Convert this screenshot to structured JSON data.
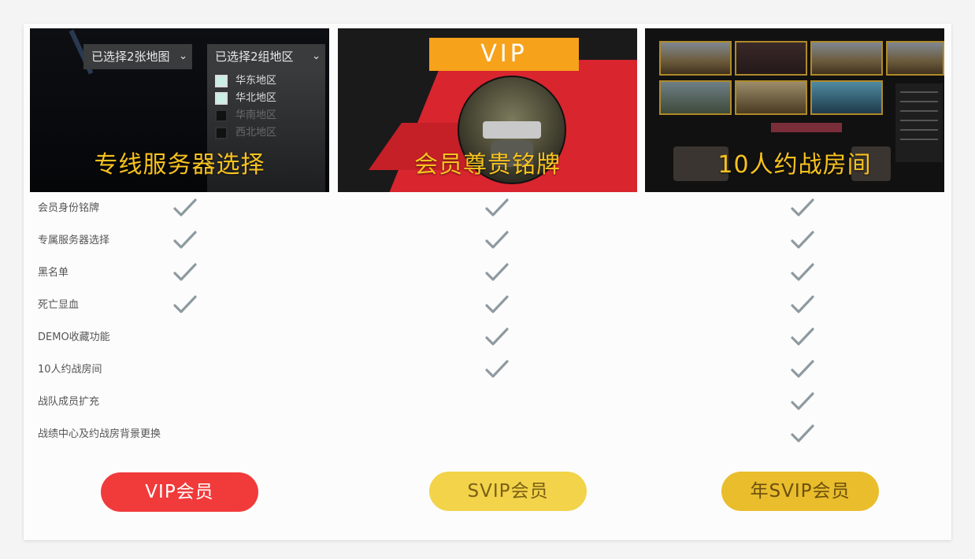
{
  "banners": [
    {
      "title": "专线服务器选择",
      "dropdown_maps": "已选择2张地图",
      "dropdown_regions": "已选择2组地区",
      "regions": [
        "华东地区",
        "华北地区",
        "华南地区",
        "西北地区"
      ]
    },
    {
      "title": "会员尊贵铭牌",
      "badge": "VIP"
    },
    {
      "title": "10人约战房间"
    }
  ],
  "features": [
    {
      "label": "会员身份铭牌",
      "vip": true,
      "svip": true,
      "year_svip": true
    },
    {
      "label": "专属服务器选择",
      "vip": true,
      "svip": true,
      "year_svip": true
    },
    {
      "label": "黑名单",
      "vip": true,
      "svip": true,
      "year_svip": true
    },
    {
      "label": "死亡显血",
      "vip": true,
      "svip": true,
      "year_svip": true
    },
    {
      "label": "DEMO收藏功能",
      "vip": false,
      "svip": true,
      "year_svip": true
    },
    {
      "label": "10人约战房间",
      "vip": false,
      "svip": true,
      "year_svip": true
    },
    {
      "label": "战队成员扩充",
      "vip": false,
      "svip": false,
      "year_svip": true
    },
    {
      "label": "战绩中心及约战房背景更换",
      "vip": false,
      "svip": false,
      "year_svip": true
    }
  ],
  "buttons": {
    "vip": "VIP会员",
    "svip": "SVIP会员",
    "year_svip": "年SVIP会员"
  },
  "colors": {
    "banner_title": "#f7c21f",
    "vip_button": "#f13a3a",
    "svip_button": "#f2d34a",
    "year_svip_button": "#e9bd2c",
    "check": "#8e9aa0"
  }
}
